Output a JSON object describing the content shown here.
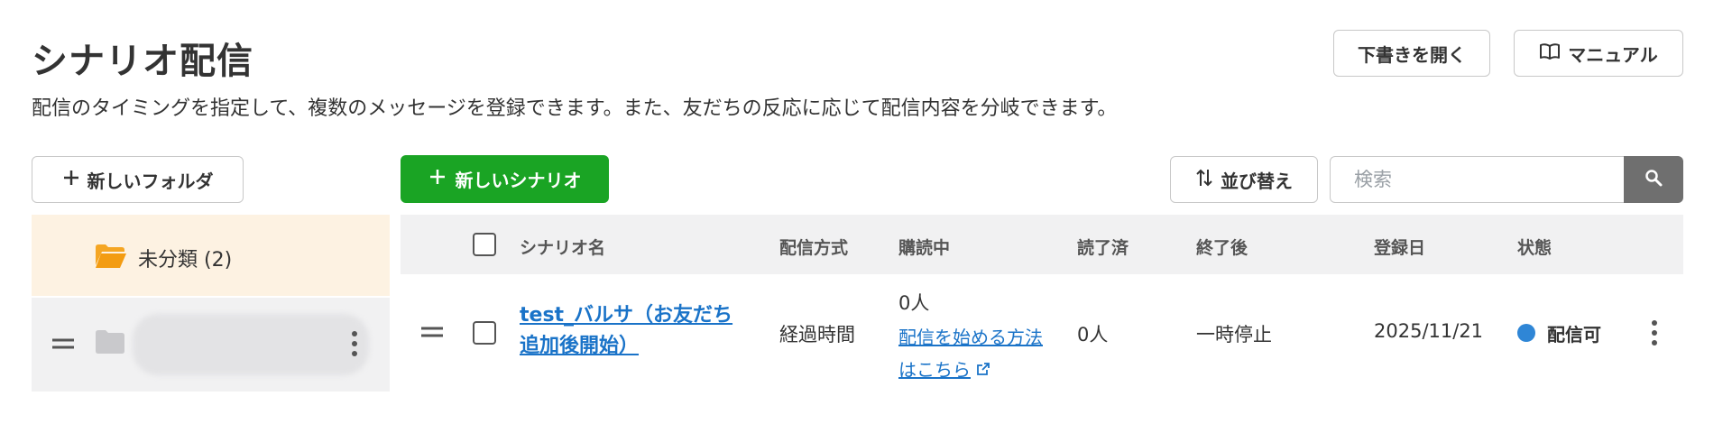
{
  "header": {
    "title": "シナリオ配信",
    "description": "配信のタイミングを指定して、複数のメッセージを登録できます。また、友だちの反応に応じて配信内容を分岐できます。",
    "draft_button": "下書きを開く",
    "manual_button": "マニュアル"
  },
  "toolbar": {
    "new_folder_label": "新しいフォルダ",
    "new_scenario_label": "新しいシナリオ",
    "sort_label": "並び替え",
    "search_placeholder": "検索"
  },
  "sidebar": {
    "items": [
      {
        "label": "未分類 (2)"
      }
    ]
  },
  "table": {
    "columns": [
      "シナリオ名",
      "配信方式",
      "購読中",
      "読了済",
      "終了後",
      "登録日",
      "状態"
    ],
    "rows": [
      {
        "name_line1": "test_バルサ（お友だち",
        "name_line2": "追加後開始）",
        "method": "経過時間",
        "subscribers": "0人",
        "howto_line1": "配信を始める方法",
        "howto_line2": "はこちら",
        "read": "0人",
        "after_end": "一時停止",
        "registered": "2025/11/21",
        "status": "配信可"
      }
    ]
  },
  "colors": {
    "primary_green": "#1aa424",
    "link_blue": "#1a73c8",
    "status_blue": "#2f86d6",
    "folder_orange": "#f39c12"
  }
}
